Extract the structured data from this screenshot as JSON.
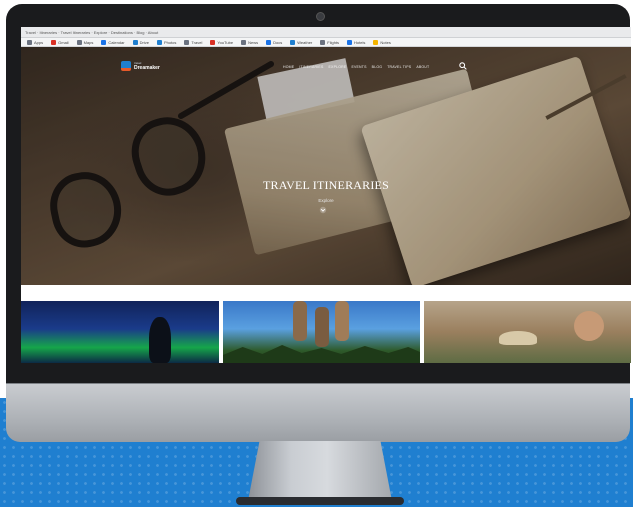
{
  "browser": {
    "tab_strip_text": "Travel · Itineraries · Travel Itineraries · Explore · Destinations · Blog · About",
    "bookmarks": [
      {
        "label": "Apps",
        "color": "#6b7280"
      },
      {
        "label": "Gmail",
        "color": "#d93025"
      },
      {
        "label": "Maps",
        "color": "#6b7280"
      },
      {
        "label": "Calendar",
        "color": "#1a73e8"
      },
      {
        "label": "Drive",
        "color": "#1f7fd0"
      },
      {
        "label": "Photos",
        "color": "#1f7fd0"
      },
      {
        "label": "Travel",
        "color": "#6b7280"
      },
      {
        "label": "YouTube",
        "color": "#d93025"
      },
      {
        "label": "News",
        "color": "#6b7280"
      },
      {
        "label": "Docs",
        "color": "#1a73e8"
      },
      {
        "label": "Weather",
        "color": "#1f7fd0"
      },
      {
        "label": "Flights",
        "color": "#6b7280"
      },
      {
        "label": "Hotels",
        "color": "#1a73e8"
      },
      {
        "label": "Notes",
        "color": "#f4b400"
      }
    ]
  },
  "site": {
    "logo_small": "travel",
    "logo_main": "Dreamaker",
    "nav": [
      "HOME",
      "ITINERARIES",
      "EXPLORE",
      "EVENTS",
      "BLOG",
      "TRAVEL TIPS",
      "ABOUT"
    ],
    "hero_title": "TRAVEL ITINERARIES",
    "hero_subtitle": "Explore"
  },
  "colors": {
    "brand": "#1f7fd0",
    "accent": "#e65a2a"
  }
}
